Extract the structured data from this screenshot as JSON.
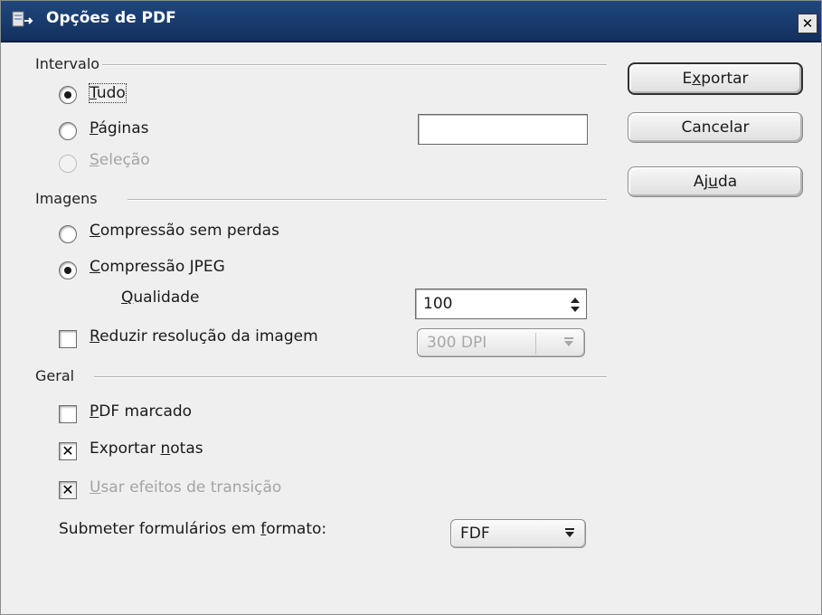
{
  "window": {
    "title": "Opções de PDF"
  },
  "sections": {
    "range": "Intervalo",
    "images": "Imagens",
    "general": "Geral"
  },
  "range": {
    "all": {
      "pre": "",
      "mn": "T",
      "post": "udo"
    },
    "pages": {
      "pre": "",
      "mn": "P",
      "post": "áginas"
    },
    "selection": {
      "pre": "",
      "mn": "S",
      "post": "eleção"
    },
    "pages_value": ""
  },
  "images": {
    "lossless": {
      "pre": "",
      "mn": "C",
      "post": "ompressão sem perdas"
    },
    "jpeg": {
      "pre": "",
      "mn": "C",
      "post": "ompressão JPEG"
    },
    "quality": {
      "pre": "",
      "mn": "Q",
      "post": "ualidade"
    },
    "quality_value": "100",
    "reduce": {
      "pre": "",
      "mn": "R",
      "post": "eduzir resolução da imagem"
    },
    "resolution_value": "300 DPI"
  },
  "general": {
    "tagged": {
      "pre": "",
      "mn": "P",
      "post": "DF marcado"
    },
    "export_notes": {
      "pre": "Exportar ",
      "mn": "n",
      "post": "otas"
    },
    "transitions": {
      "pre": "",
      "mn": "U",
      "post": "sar efeitos de transição"
    },
    "submit_format": {
      "pre": "Submeter formulários em ",
      "mn": "f",
      "post": "ormato:"
    },
    "submit_format_value": "FDF"
  },
  "buttons": {
    "export": {
      "pre": "E",
      "mn": "x",
      "post": "portar"
    },
    "cancel": "Cancelar",
    "help": {
      "pre": "Aj",
      "mn": "u",
      "post": "da"
    }
  },
  "state": {
    "range_selected": "all",
    "image_compression": "jpeg",
    "reduce_resolution": false,
    "tagged_pdf": false,
    "export_notes": true,
    "use_transitions": true
  },
  "icons": [
    "app-window-icon",
    "close-icon",
    "spin-arrows-icon",
    "dropdown-arrow-icon"
  ]
}
